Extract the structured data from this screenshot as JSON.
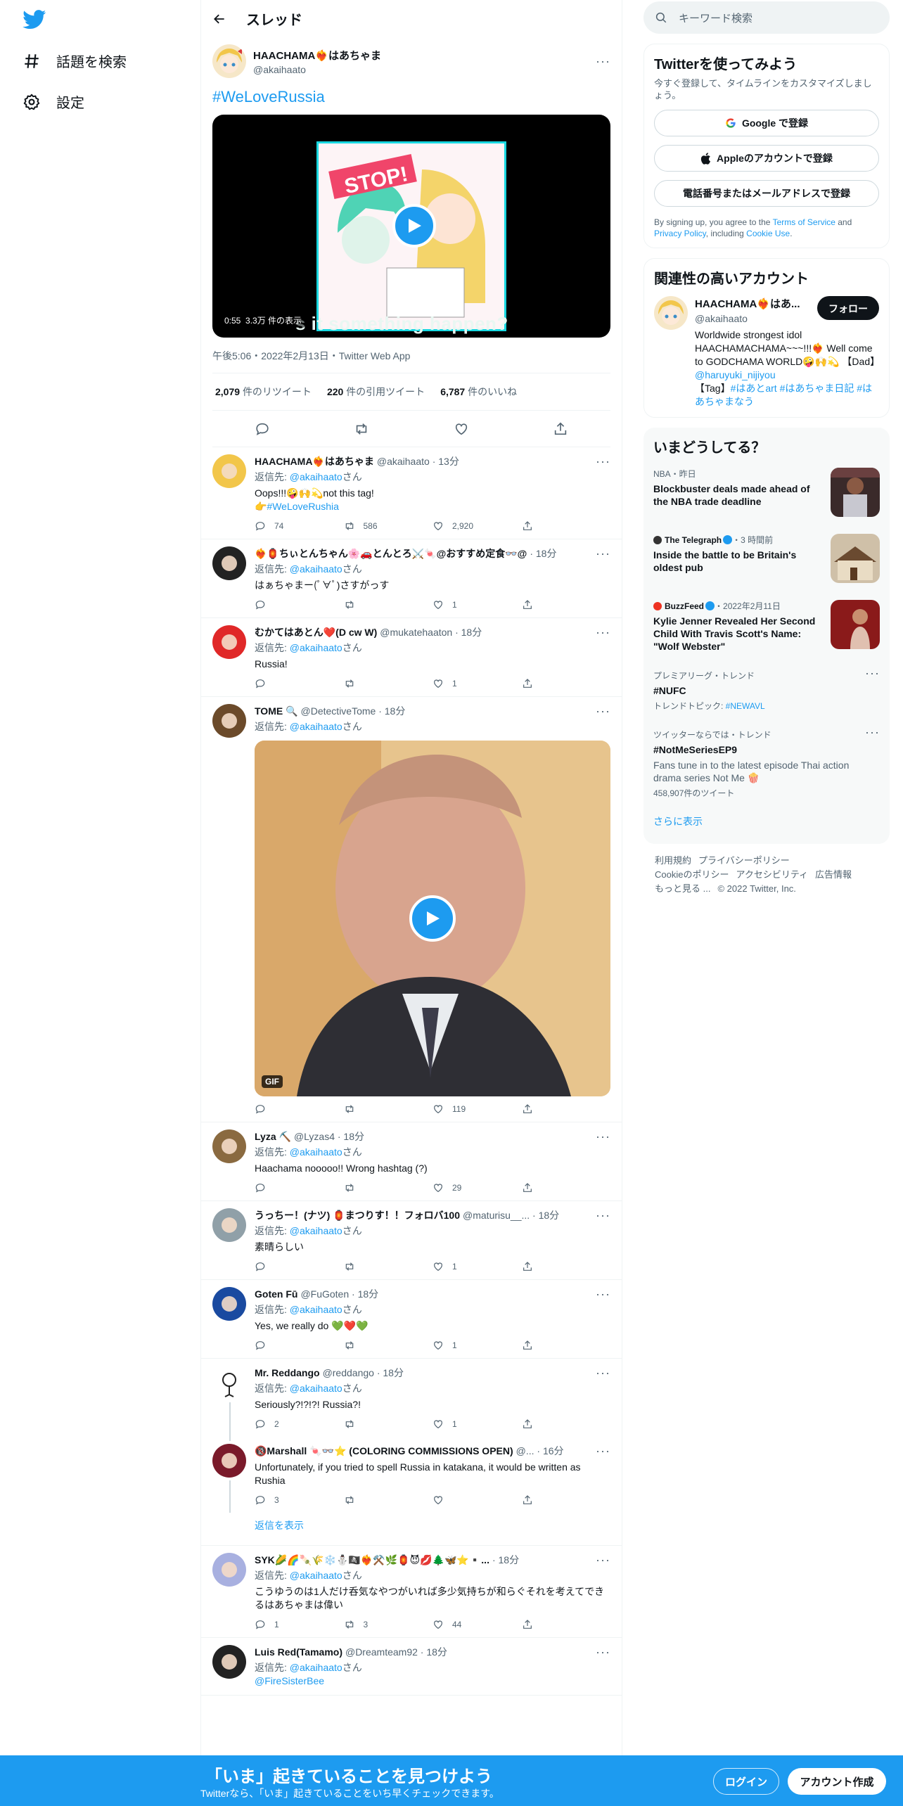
{
  "nav": {
    "explore": "話題を検索",
    "settings": "設定"
  },
  "header": {
    "title": "スレッド"
  },
  "focal": {
    "name": "HAACHAMA❤️‍🔥はあちゃま",
    "handle": "@akaihaato",
    "text": "#WeLoveRussia",
    "video_time": "0:55",
    "video_views": "3.3万 件の表示",
    "video_caption": "s it something happen?",
    "timestamp": "午後5:06・2022年2月13日・Twitter Web App",
    "retweets": "2,079",
    "retweets_label": "件のリツイート",
    "quotes": "220",
    "quotes_label": "件の引用ツイート",
    "likes": "6,787",
    "likes_label": "件のいいね"
  },
  "replying_label": "返信先:",
  "replying_suffix": "さん",
  "replying_handle": "@akaihaato",
  "tweets": [
    {
      "name": "HAACHAMA❤️‍🔥はあちゃま",
      "handle": "@akaihaato · 13分",
      "text": "Oops!!!🤪🙌💫not this tag!",
      "link": "👉#WeLoveRushia",
      "replies": "74",
      "retweets": "586",
      "likes": "2,920"
    },
    {
      "name": "❤️‍🔥🏮ちぃとんちゃん🌸🚗とんとろ⚔️🍬@おすすめ定食👓@",
      "handle": "· 18分",
      "text": "はぁちゃまー(ﾟ∀ﾟ)さすがっす",
      "replies": "",
      "retweets": "",
      "likes": "1"
    },
    {
      "name": "むかてはあとん❤️(D cw W)",
      "handle": "@mukatehaaton · 18分",
      "text": "Russia!",
      "replies": "",
      "retweets": "",
      "likes": "1"
    },
    {
      "name": "TOME 🔍",
      "handle": "@DetectiveTome · 18分",
      "text": "",
      "gif": "GIF",
      "replies": "",
      "retweets": "",
      "likes": "119"
    },
    {
      "name": "Lyza ⛏️",
      "handle": "@Lyzas4 · 18分",
      "text": "Haachama nooooo!! Wrong hashtag (?)",
      "replies": "",
      "retweets": "",
      "likes": "29"
    },
    {
      "name": "うっちー！(ナツ) 🏮まつりす！！フォロバ100",
      "handle": "@maturisu__... · 18分",
      "text": "素晴らしい",
      "replies": "",
      "retweets": "",
      "likes": "1"
    },
    {
      "name": "Goten Fū",
      "handle": "@FuGoten · 18分",
      "text": "Yes, we really do 💚❤️💚",
      "replies": "",
      "retweets": "",
      "likes": "1"
    },
    {
      "name": "Mr. Reddango",
      "handle": "@reddango · 18分",
      "text": "Seriously?!?!?! Russia?!",
      "replies": "2",
      "retweets": "",
      "likes": "1"
    },
    {
      "name": "🔞Marshall 🍬👓⭐ (COLORING COMMISSIONS OPEN)",
      "handle": "@... · 16分",
      "text": "Unfortunately, if you tried to spell Russia in katakana, it would be written as Rushia",
      "replies": "3",
      "retweets": "",
      "likes": ""
    },
    {
      "name": "SYK🌽🌈🍡🌾❄️⛄🏴‍☠️❤️‍🔥⚒️🌿🏮😈💋🌲🦋⭐▪️...",
      "handle": "· 18分",
      "text": "こうゆうのは1人だけ呑気なやつがいれば多少気持ちが和らぐそれを考えてできるはあちゃまは偉い",
      "replies": "1",
      "retweets": "3",
      "likes": "44"
    },
    {
      "name": "Luis Red(Tamamo)",
      "handle": "@Dreamteam92 · 18分",
      "text": "",
      "extra": "@FireSisterBee"
    }
  ],
  "show_replies": "返信を表示",
  "right": {
    "search_placeholder": "キーワード検索",
    "signup": {
      "title": "Twitterを使ってみよう",
      "subtitle": "今すぐ登録して、タイムラインをカスタマイズしましょう。",
      "google": "Google で登録",
      "apple": "Appleのアカウントで登録",
      "phone": "電話番号またはメールアドレスで登録",
      "legal_1": "By signing up, you agree to the ",
      "tos": "Terms of Service",
      "legal_2": " and ",
      "privacy": "Privacy Policy",
      "legal_3": ", including ",
      "cookie": "Cookie Use",
      "legal_4": "."
    },
    "relevant": {
      "title": "関連性の高いアカウント",
      "name": "HAACHAMA❤️‍🔥はあ...",
      "handle": "@akaihaato",
      "follow": "フォロー",
      "bio_1": "Worldwide strongest idol HAACHAMACHAMA~~~!!!❤️‍🔥 Well come to GODCHAMA WORLD🤪🙌💫 【Dad】",
      "bio_dad": "@haruyuki_nijiyou",
      "bio_2": "【Tag】",
      "bio_tags": "#はあとart #はあちゃま日記 #はあちゃまなう"
    },
    "trends": {
      "title": "いまどうしてる？",
      "items": [
        {
          "meta": "NBA・昨日",
          "title": "Blockbuster deals made ahead of the NBA trade deadline"
        },
        {
          "source": "The Telegraph",
          "meta": "・3 時間前",
          "title": "Inside the battle to be Britain's oldest pub"
        },
        {
          "source": "BuzzFeed",
          "meta": "・2022年2月11日",
          "title": "Kylie Jenner Revealed Her Second Child With Travis Scott's Name: \"Wolf Webster\""
        }
      ],
      "t1_meta": "プレミアリーグ・トレンド",
      "t1_title": "#NUFC",
      "t1_sub_label": "トレンドトピック: ",
      "t1_sub_tag": "#NEWAVL",
      "t2_meta": "ツイッターならでは・トレンド",
      "t2_title": "#NotMeSeriesEP9",
      "t2_desc": "Fans tune in to the latest episode Thai action drama series Not Me 🍿",
      "t2_count": "458,907件のツイート",
      "show_more": "さらに表示"
    },
    "footer": {
      "terms": "利用規約",
      "privacy": "プライバシーポリシー",
      "cookie": "Cookieのポリシー",
      "accessibility": "アクセシビリティ",
      "ads": "広告情報",
      "more": "もっと見る ...",
      "copyright": "© 2022 Twitter, Inc."
    }
  },
  "bottom": {
    "title": "「いま」起きていることを見つけよう",
    "sub": "Twitterなら、「いま」起きていることをいち早くチェックできます。",
    "login": "ログイン",
    "signup": "アカウント作成"
  },
  "colors": {
    "accent": "#1d9bf0",
    "text": "#0f1419",
    "muted": "#536471"
  }
}
